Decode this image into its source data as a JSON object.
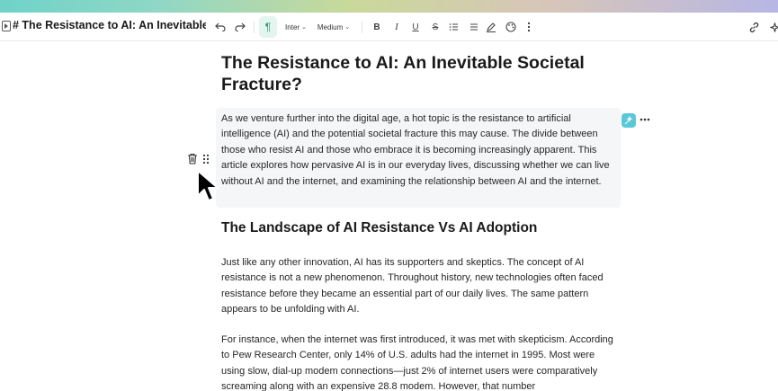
{
  "toolbar": {
    "doc_title": "# The Resistance to AI: An Inevitable Soc",
    "undo_icon": "undo-icon",
    "redo_icon": "redo-icon",
    "paragraph_icon": "¶",
    "font": "Inter",
    "weight": "Medium",
    "bold": "B",
    "italic": "I",
    "underline": "U",
    "strike": "S"
  },
  "document": {
    "title": "The Resistance to AI: An Inevitable Societal Fracture?",
    "intro": "As we venture further into the digital age, a hot topic is the resistance to artificial intelligence (AI) and the potential societal fracture this may cause. The divide between those who resist AI and those who embrace it is becoming increasingly apparent. This article explores how pervasive AI is in our everyday lives, discussing whether we can live without AI and the internet, and examining the relationship between AI and the internet.",
    "section_heading": "The Landscape of AI Resistance Vs AI Adoption",
    "para2": "Just like any other innovation, AI has its supporters and skeptics. The concept of AI resistance is not a new phenomenon. Throughout history, new technologies often faced resistance before they became an essential part of our daily lives. The same pattern appears to be unfolding with AI.",
    "para3": "For instance, when the internet was first introduced, it was met with skepticism. According to Pew Research Center, only 14% of U.S. adults had the internet in 1995. Most were using slow, dial-up modem connections—just 2% of internet users were comparatively screaming along with an expensive 28.8 modem. However, that number"
  },
  "colors": {
    "accent": "#2e9b73",
    "ai_button": "#5ac8d6",
    "block_highlight": "#f4f6f8"
  }
}
